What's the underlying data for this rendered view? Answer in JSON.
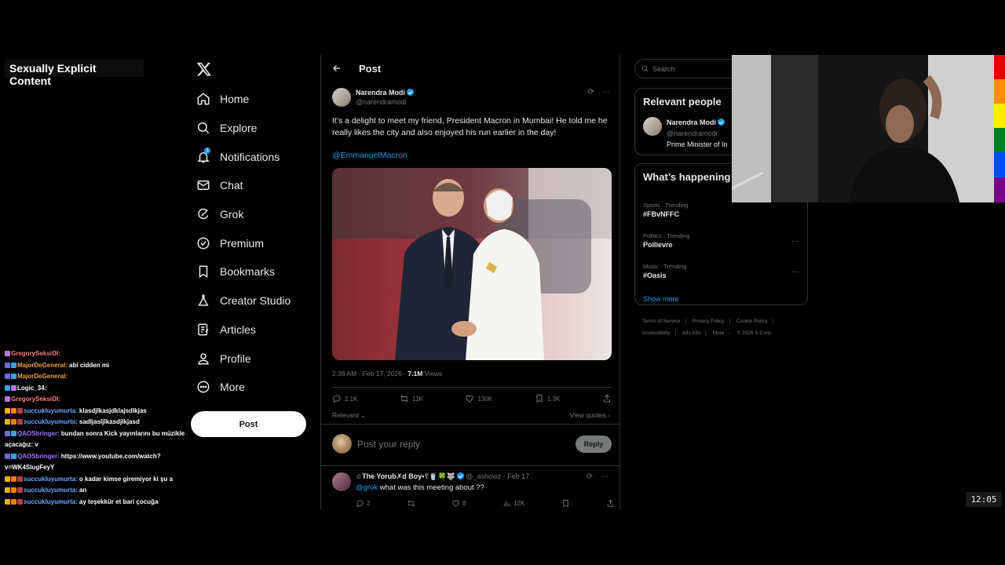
{
  "overlay": {
    "warning": "Sexually Explicit Content",
    "clock": "12:05",
    "chat": [
      {
        "user": "GregorySeksiOl:",
        "color": "#ff7a7a",
        "msg": "",
        "badges": [
          "#b57bd8"
        ]
      },
      {
        "user": "MajorDeGeneral:",
        "color": "#f0a030",
        "msg": "abi cidden mi",
        "badges": [
          "#6b6bd8",
          "#3aa0e0"
        ]
      },
      {
        "user": "MajorDeGeneral:",
        "color": "#f0a030",
        "msg": "",
        "badges": [
          "#6b6bd8",
          "#3aa0e0"
        ]
      },
      {
        "user": "Logic_34:",
        "color": "#ffffff",
        "msg": "",
        "badges": [
          "#3aa0e0",
          "#b57bd8"
        ]
      },
      {
        "user": "GregorySeksiOl:",
        "color": "#ff7a7a",
        "msg": "",
        "badges": [
          "#b57bd8"
        ]
      },
      {
        "user": "succukluyumurta:",
        "color": "#6aa8ff",
        "msg": "klasdjlkasjdklajsdlkjas",
        "badges": [
          "#f0b000",
          "#f08000",
          "#b04040"
        ]
      },
      {
        "user": "succukluyumurta:",
        "color": "#6aa8ff",
        "msg": "sadljasljlkasdjlkjasd",
        "badges": [
          "#f0b000",
          "#f08000",
          "#b04040"
        ]
      },
      {
        "user": "QAOSbringer:",
        "color": "#a070ff",
        "msg": "bundan sonra Kick yayınlarını bu müzikle açacağız: v",
        "badges": [
          "#6b6bd8",
          "#3aa0e0"
        ]
      },
      {
        "user": "QAOSbringer:",
        "color": "#a070ff",
        "msg": "https://www.youtube.com/watch?v=WK4SlugFeyY",
        "badges": [
          "#6b6bd8",
          "#3aa0e0"
        ]
      },
      {
        "user": "succukluyumurta:",
        "color": "#6aa8ff",
        "msg": "o kadar kimse giremiyor ki şu a",
        "badges": [
          "#f0b000",
          "#f08000",
          "#b04040"
        ]
      },
      {
        "user": "succukluyumurta:",
        "color": "#6aa8ff",
        "msg": "an",
        "badges": [
          "#f0b000",
          "#f08000",
          "#b04040"
        ]
      },
      {
        "user": "succukluyumurta:",
        "color": "#6aa8ff",
        "msg": "ay teşekkür et bari çocuğa",
        "badges": [
          "#f0b000",
          "#f08000",
          "#b04040"
        ]
      }
    ]
  },
  "nav": {
    "items": [
      {
        "label": "Home",
        "icon": "home-icon"
      },
      {
        "label": "Explore",
        "icon": "search-icon"
      },
      {
        "label": "Notifications",
        "icon": "bell-icon",
        "badge": "1"
      },
      {
        "label": "Chat",
        "icon": "mail-icon"
      },
      {
        "label": "Grok",
        "icon": "grok-icon"
      },
      {
        "label": "Premium",
        "icon": "premium-icon"
      },
      {
        "label": "Bookmarks",
        "icon": "bookmark-icon"
      },
      {
        "label": "Creator Studio",
        "icon": "flask-icon"
      },
      {
        "label": "Articles",
        "icon": "article-icon"
      },
      {
        "label": "Profile",
        "icon": "person-icon"
      },
      {
        "label": "More",
        "icon": "more-circle-icon"
      }
    ],
    "post_label": "Post"
  },
  "main": {
    "header_title": "Post",
    "author_name": "Narendra Modi",
    "author_handle": "@narendramodi",
    "text": "It’s a delight to meet my friend, President Macron in Mumbai! He told me he really likes the city and also enjoyed his run earlier in the day!",
    "mention": "@EmmanuelMacron",
    "meta_time": "2:38 AM · Feb 17, 2026 · ",
    "meta_views": "7.1M",
    "meta_views_label": " Views",
    "actions": {
      "replies": "2.1K",
      "reposts": "11K",
      "likes": "130K",
      "bookmarks": "1.3K"
    },
    "sort_label": "Relevant",
    "view_quotes": "View quotes",
    "reply_placeholder": "Post your reply",
    "reply_button": "Reply",
    "reply_tweet": {
      "name": "☆The Yorub✗d Boy•☦🥤🍀🐺",
      "handle": "@_ashowz · Feb 17",
      "mention": "@grok",
      "text": " what was this meeting about ??",
      "replies": "2",
      "likes": "8",
      "views": "12K"
    }
  },
  "right": {
    "search_placeholder": "Search",
    "relevant_title": "Relevant people",
    "rp_name": "Narendra Modi",
    "rp_handle": "@narendramodi",
    "rp_bio": "Prime Minister of In",
    "happening_title": "What’s happening",
    "trends": [
      {
        "cat": "Sports · Trending",
        "name": "#FBvNFFC"
      },
      {
        "cat": "Politics · Trending",
        "name": "Poilievre"
      },
      {
        "cat": "Music · Trending",
        "name": "#Oasis"
      }
    ],
    "show_more": "Show more",
    "footer": [
      "Terms of Service",
      "|",
      "Privacy Policy",
      "|",
      "Cookie Policy",
      "|",
      "Accessibility",
      "|",
      "Ads info",
      "|",
      "More ···",
      "© 2026 X Corp."
    ]
  },
  "colors": {
    "accent": "#1d9bf0",
    "bg": "#000000",
    "border": "#2f3336",
    "muted": "#71767b"
  }
}
